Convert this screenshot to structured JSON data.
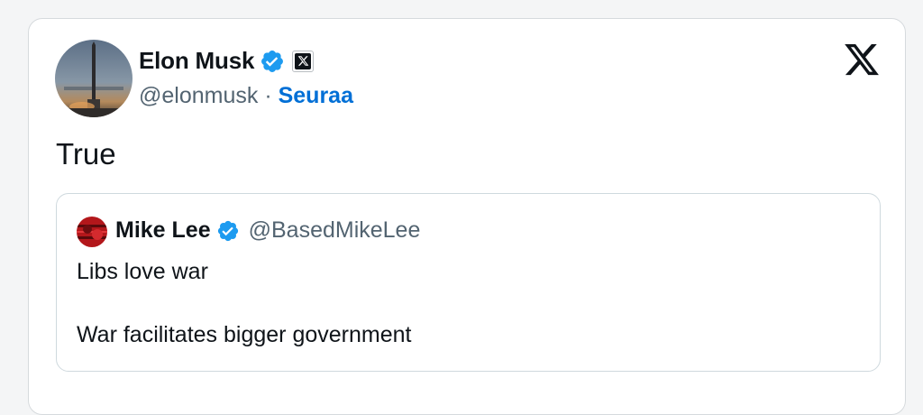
{
  "tweet": {
    "author": {
      "name": "Elon Musk",
      "handle": "@elonmusk",
      "separator": " · ",
      "follow_label": "Seuraa"
    },
    "text": "True",
    "quoted": {
      "name": "Mike Lee",
      "handle": "@BasedMikeLee",
      "line1": "Libs love war",
      "line2": "War facilitates bigger government"
    }
  },
  "icons": {
    "verified": "verified-badge-icon",
    "affiliate": "x-affiliate-badge-icon",
    "brand": "x-logo-icon"
  },
  "colors": {
    "verified_blue": "#1d9bf0",
    "follow_blue": "#006fd6",
    "text_primary": "#0f1419",
    "text_secondary": "#536471"
  }
}
